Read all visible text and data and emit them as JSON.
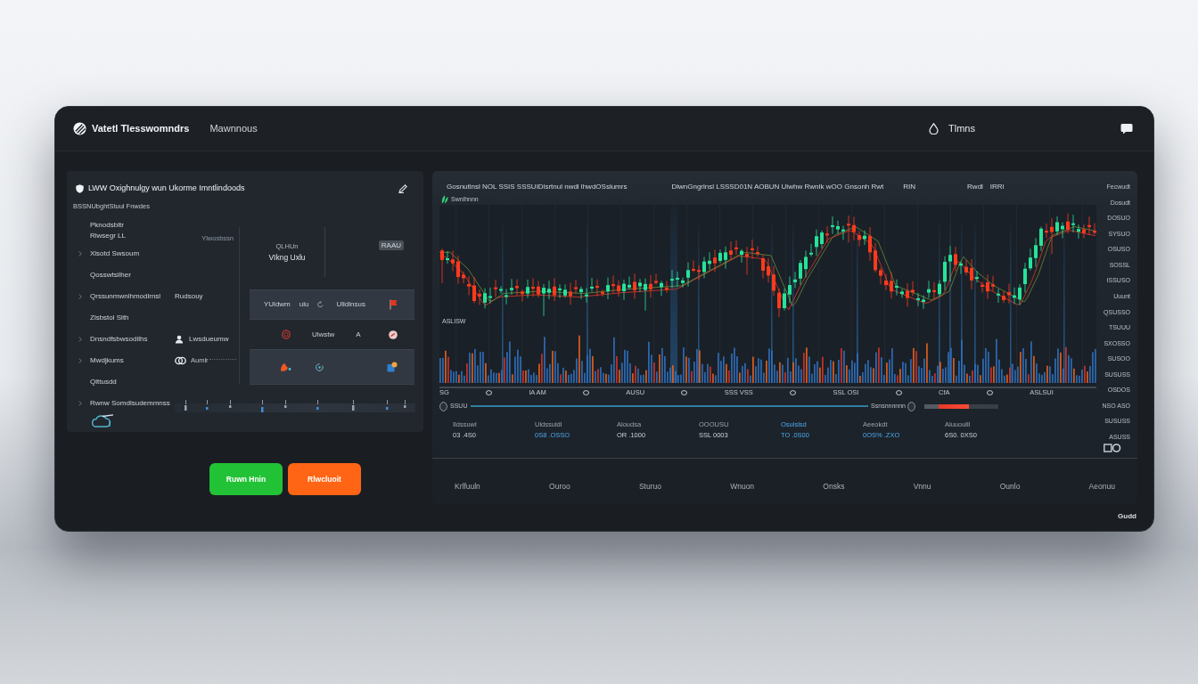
{
  "header": {
    "brand": "Vatetl Tlesswomndrs",
    "nav": "Mawnnous",
    "user": "Tlmns"
  },
  "left_panel": {
    "title": "LWW Oxighnulgy wun Ukorme Imntlindoods",
    "subtitle": "BSSNUbghtStuul Fnwdes",
    "rows": [
      {
        "label": "Pknodsbltr",
        "label_2": "Rlwsegr LL",
        "expandable": false,
        "detail": {
          "kind": "note",
          "text": "Ylwosbssn"
        }
      },
      {
        "label": "Xlsotd Swsoum",
        "expandable": true
      },
      {
        "label": "Qosswtsilher",
        "expandable": false
      },
      {
        "label": "Qrssunmwnlhmodlrnsl",
        "expandable": true,
        "detail": {
          "kind": "text",
          "text": "Rudsouy"
        }
      },
      {
        "label": "Zlsbstol Slth",
        "expandable": false
      },
      {
        "label": "Dnsndfsbwsodilhs",
        "expandable": true,
        "detail": {
          "kind": "user",
          "text": "Lwsdueumw"
        }
      },
      {
        "label": "Mwdjkums",
        "expandable": true,
        "detail": {
          "kind": "link",
          "text": "Aumlr"
        }
      },
      {
        "label": "Qlttusdd",
        "expandable": false
      }
    ],
    "footer_row": {
      "label": "Rwnw Somdlsudemmnss",
      "expandable": true
    },
    "card": {
      "lines": [
        "QLHUn",
        "VIkng Uxlu"
      ]
    },
    "tag": "RAAU",
    "activity": [
      {
        "texts": [
          "YUldwm",
          "ulu",
          "Ulldlnsus"
        ],
        "highlighted": true
      },
      {
        "texts": [
          "Ulwstw",
          "A"
        ],
        "highlighted": false
      },
      {
        "highlighted": true
      }
    ]
  },
  "buttons": [
    {
      "label": "Ruwn Hnin",
      "kind": "primary"
    },
    {
      "label": "Rlwcluoit",
      "kind": "danger"
    }
  ],
  "chart_panel": {
    "header": [
      "Gosnutlnsl NOL SSIS SSSUIDlsrtnul nwdl lhwdOSslumrs",
      "DlwnGngrlnsl LSSSD01N AOBUN Ulwhw RwnIk wOO Gnsonh Rwt",
      "RIN",
      "Rwdl",
      "IRRl"
    ],
    "legend": "Swnlhnnn",
    "overlay_label": "ASLISW",
    "x_labels": [
      "SG",
      "lA AM",
      "AUSU",
      "SSS VSS",
      "SSL OSI",
      "CfA",
      "ASLSUI"
    ],
    "scrubber": {
      "label": "SSUU",
      "reading": "Ssnsnnnnnn",
      "level": 1
    },
    "progress": {
      "level": 0.6
    },
    "stats": [
      {
        "label": "Ildssuwl",
        "value": "03 .4S0",
        "label_accent": false,
        "value_accent": false
      },
      {
        "label": "Uldssuldl",
        "value": "0S8 .OSSO",
        "label_accent": false,
        "value_accent": true
      },
      {
        "label": "Aloudsa",
        "value": "OR .1000",
        "label_accent": false,
        "value_accent": false
      },
      {
        "label": "OOOUSU",
        "value": "SSL 0003",
        "label_accent": false,
        "value_accent": false
      },
      {
        "label": "Osulslsd",
        "value": "TO .0S00",
        "label_accent": true,
        "value_accent": true
      },
      {
        "label": "Aeeokdt",
        "value": "0OS% .ZXO",
        "label_accent": false,
        "value_accent": true
      },
      {
        "label": "Aluuoulll",
        "value": "6S0. 0XS0",
        "label_accent": false,
        "value_accent": false
      }
    ],
    "axis_labels": [
      "Fecwudt",
      "Dosudt",
      "DOSUO",
      "SYSUO",
      "OSUSO",
      "SOSSL",
      "ISSUSO",
      "Uuunt",
      "QSUSSO",
      "TSUUU",
      "SXOSSO",
      "SUSOO",
      "SUSUSS",
      "OSDOS",
      "NSO ASO",
      "SUSUSS",
      "ASUSS"
    ]
  },
  "table": {
    "columns": [
      "Krlfuuln",
      "Ouroo",
      "Sturuo",
      "Wnuon",
      "Onsks",
      "Vnnu",
      "Ounlo",
      "Aeonuu"
    ]
  },
  "footer": {
    "text": "Gudd"
  }
}
